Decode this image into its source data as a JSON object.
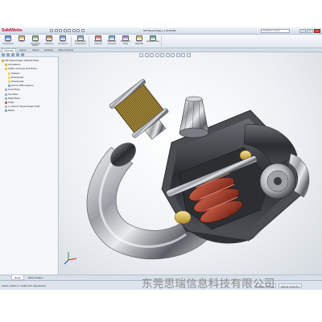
{
  "app": {
    "brand": "SolidWorks",
    "document_title": "SW Supercharger_1.SLDASM",
    "menu": [],
    "search_placeholder": "SolidWorks Search"
  },
  "ribbon": {
    "buttons": [
      {
        "label": "Insert Components",
        "icon": "insert-components-icon"
      },
      {
        "label": "Mate",
        "icon": "mate-icon"
      },
      {
        "label": "Linear Component Pattern",
        "icon": "linear-pattern-icon"
      },
      {
        "label": "Smart Fasteners",
        "icon": "smart-fasteners-icon"
      },
      {
        "label": "Move Component",
        "icon": "move-component-icon"
      },
      {
        "label": "Show Hidden Components",
        "icon": "show-hidden-icon"
      },
      {
        "label": "Assembly Features",
        "icon": "assembly-features-icon"
      },
      {
        "label": "Reference Geometry",
        "icon": "reference-geometry-icon"
      },
      {
        "label": "New Motion Study",
        "icon": "motion-study-icon"
      },
      {
        "label": "Bill of Materials",
        "icon": "bom-icon"
      },
      {
        "label": "Exploded View",
        "icon": "exploded-view-icon"
      }
    ]
  },
  "tabs": [
    "Assembly",
    "Layout",
    "Sketch",
    "Evaluate",
    "Office Products"
  ],
  "tree": {
    "items": [
      {
        "label": "SW Supercharger (Default<Displ",
        "indent": 0,
        "color": "#e0a23c"
      },
      {
        "label": "Annotations",
        "indent": 1,
        "color": "#d9b85a"
      },
      {
        "label": "Lights, Cameras and Scene",
        "indent": 1,
        "color": "#e5c04a"
      },
      {
        "label": "Ambient",
        "indent": 2,
        "color": "#e8d36a"
      },
      {
        "label": "Directional1",
        "indent": 2,
        "color": "#e8d36a"
      },
      {
        "label": "Directional2",
        "indent": 2,
        "color": "#e8d36a"
      },
      {
        "label": "Scene (Office Space)",
        "indent": 2,
        "color": "#7da7d6"
      },
      {
        "label": "Front Plane",
        "indent": 1,
        "color": "#9cb5d0"
      },
      {
        "label": "Top Plane",
        "indent": 1,
        "color": "#9cb5d0"
      },
      {
        "label": "Right Plane",
        "indent": 1,
        "color": "#9cb5d0"
      },
      {
        "label": "Origin",
        "indent": 1,
        "color": "#c06a4f"
      },
      {
        "label": "(-) Generic Supercharger Final",
        "indent": 1,
        "color": "#b2b9c2"
      },
      {
        "label": "Mates",
        "indent": 1,
        "color": "#8fa4bd"
      }
    ]
  },
  "model_tabs": [
    "Model",
    "Motion Study 1"
  ],
  "status": {
    "message": "Select entities to modify their appearance",
    "cells": [
      "Under Defined",
      "Editing Assembly"
    ]
  },
  "watermark": "东莞思瑞信息科技有限公司",
  "colors": {
    "brand_red": "#c8102e",
    "ribbon_bg": "#e8eef4",
    "viewport_bg": "#eef1f4"
  }
}
